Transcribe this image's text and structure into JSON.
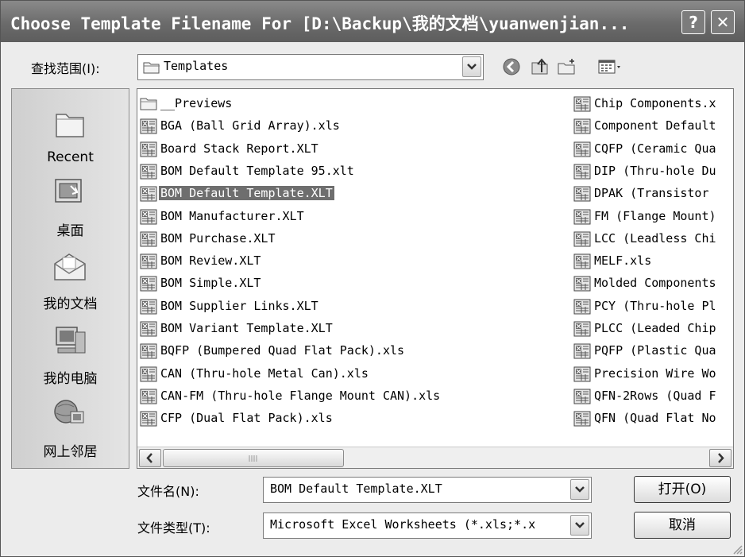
{
  "window": {
    "title": "Choose Template Filename For [D:\\Backup\\我的文档\\yuanwenjian...",
    "help_glyph": "?",
    "close_glyph": "✕"
  },
  "lookin": {
    "label": "查找范围(I):",
    "value": "Templates"
  },
  "toolbar": {
    "icons": [
      "back-icon",
      "up-folder-icon",
      "new-folder-icon",
      "views-menu-icon"
    ]
  },
  "places": [
    {
      "label": "Recent",
      "icon": "recent-icon"
    },
    {
      "label": "桌面",
      "icon": "desktop-icon"
    },
    {
      "label": "我的文档",
      "icon": "my-documents-icon"
    },
    {
      "label": "我的电脑",
      "icon": "my-computer-icon"
    },
    {
      "label": "网上邻居",
      "icon": "network-icon"
    }
  ],
  "files": {
    "column1": [
      "__Previews",
      "BGA (Ball Grid Array).xls",
      "Board Stack Report.XLT",
      "BOM Default Template 95.xlt",
      "BOM Default Template.XLT",
      "BOM Manufacturer.XLT",
      "BOM Purchase.XLT",
      "BOM Review.XLT",
      "BOM Simple.XLT",
      "BOM Supplier Links.XLT",
      "BOM Variant Template.XLT",
      "BQFP (Bumpered Quad Flat Pack).xls",
      "CAN (Thru-hole Metal Can).xls",
      "CAN-FM (Thru-hole Flange Mount CAN).xls",
      "CFP (Dual Flat Pack).xls"
    ],
    "column2": [
      "Chip Components.x",
      "Component Default",
      "CQFP (Ceramic Qua",
      "DIP (Thru-hole Du",
      "DPAK (Transistor ",
      "FM (Flange Mount)",
      "LCC (Leadless Chi",
      "MELF.xls",
      "Molded Components",
      "PCY (Thru-hole Pl",
      "PLCC (Leaded Chip",
      "PQFP (Plastic Qua",
      "Precision Wire Wo",
      "QFN-2Rows (Quad F",
      "QFN (Quad Flat No"
    ],
    "selected": "BOM Default Template.XLT"
  },
  "filename": {
    "label": "文件名(N):",
    "value": "BOM Default Template.XLT"
  },
  "filetype": {
    "label": "文件类型(T):",
    "value": "Microsoft Excel Worksheets (*.xls;*.x"
  },
  "buttons": {
    "open": "打开(O)",
    "cancel": "取消"
  }
}
